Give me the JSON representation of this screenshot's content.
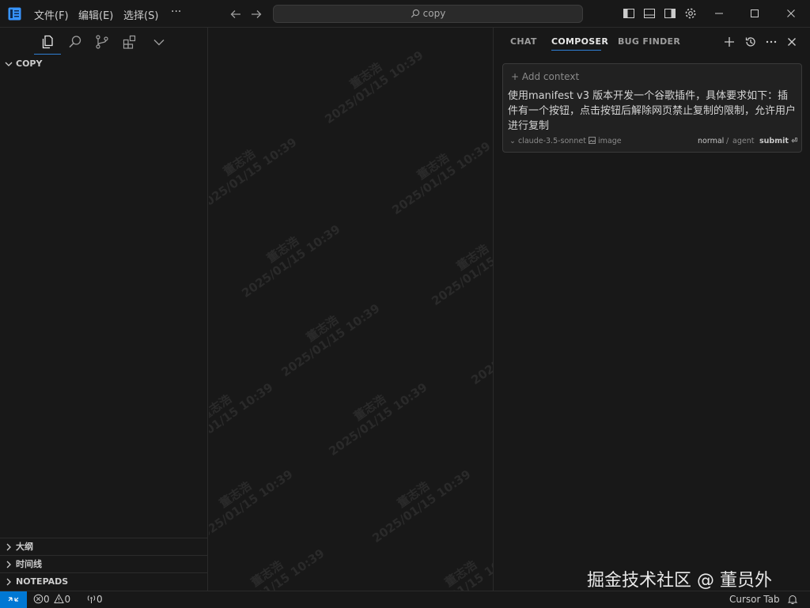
{
  "titlebar": {
    "menus": [
      "文件(F)",
      "编辑(E)",
      "选择(S)"
    ],
    "more": "···",
    "search_text": "copy"
  },
  "sidebar": {
    "section_title": "COPY",
    "bottom_sections": [
      "大纲",
      "时间线",
      "NOTEPADS"
    ]
  },
  "editor": {
    "watermark_name": "董志浩",
    "watermark_time": "2025/01/15 10:39"
  },
  "ai_panel": {
    "tabs": [
      "CHAT",
      "COMPOSER",
      "BUG FINDER"
    ],
    "active_tab": "COMPOSER",
    "add_context": "+ Add context",
    "prompt": "使用manifest v3 版本开发一个谷歌插件，具体要求如下：插件有一个按钮，点击按钮后解除网页禁止复制的限制，允许用户进行复制",
    "model": "claude-3.5-sonnet",
    "image_label": "image",
    "mode_normal": "normal",
    "mode_sep": "/",
    "mode_agent": "agent",
    "submit": "submit"
  },
  "statusbar": {
    "errors": "0",
    "warnings": "0",
    "ports": "0",
    "cursor_tab": "Cursor Tab"
  },
  "page_watermark": "掘金技术社区 @ 董员外",
  "colors": {
    "background": "#181818",
    "accent": "#0078d4",
    "tab_underline": "#2f7fd4"
  }
}
